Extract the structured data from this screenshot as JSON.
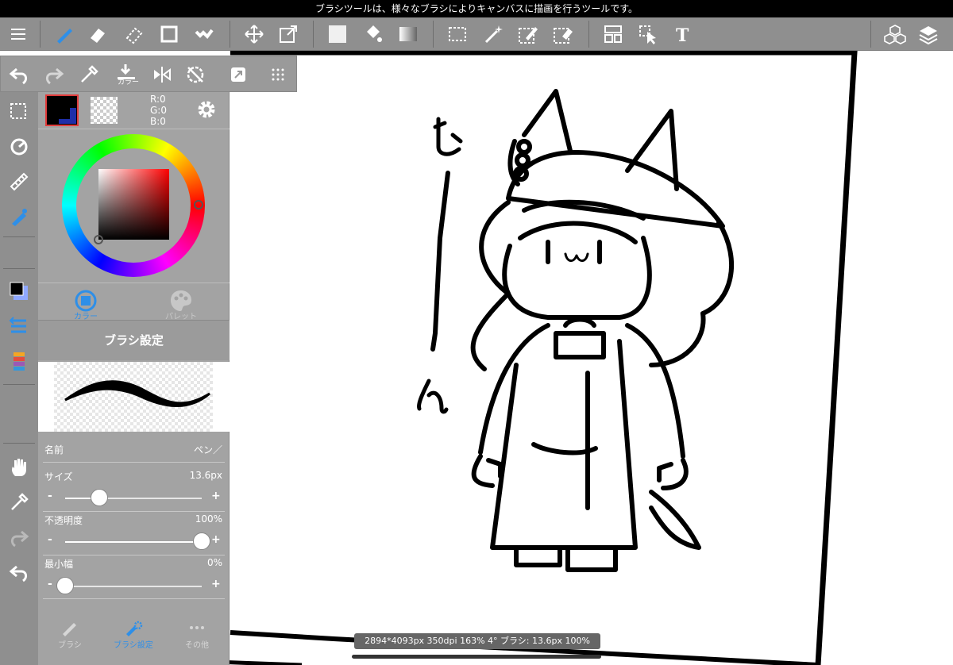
{
  "status_text": "ブラシツールは、様々なブラシによりキャンバスに描画を行うツールです。",
  "toolbar": {
    "menu_icon": "menu-icon",
    "tools": [
      "brush-icon",
      "eraser-icon",
      "blur-icon",
      "shape-icon",
      "dot-icon",
      "move-icon",
      "transform-icon",
      "fill-rect-icon",
      "bucket-icon",
      "gradient-icon",
      "select-rect-icon",
      "magic-wand-icon",
      "select-pen-icon",
      "select-eraser-icon",
      "frame-icon",
      "operation-icon",
      "text-icon",
      "material-icon",
      "layer-icon"
    ]
  },
  "subbar": {
    "extract_label": "カラー",
    "icons": [
      "undo-icon",
      "redo-icon",
      "eyedropper-icon",
      "extract-icon",
      "flip-icon",
      "rotate-reset-icon",
      "export-icon",
      "grid-icon"
    ]
  },
  "color_panel": {
    "main_color": "#000000",
    "rgb": {
      "r": "R:0",
      "g": "G:0",
      "b": "B:0"
    },
    "tabs": [
      {
        "label": "カラー",
        "icon": "color-icon",
        "active": true
      },
      {
        "label": "パレット",
        "icon": "palette-icon",
        "active": false
      }
    ]
  },
  "brush_panel": {
    "title": "ブラシ設定",
    "name_label": "名前",
    "name_value": "ペン／",
    "size": {
      "label": "サイズ",
      "value": "13.6px",
      "level": 0.25
    },
    "opacity": {
      "label": "不透明度",
      "value": "100%",
      "level": 1.0
    },
    "min_width": {
      "label": "最小幅",
      "value": "0%",
      "level": 0.0
    },
    "minus": "-",
    "plus": "+",
    "tabs": [
      {
        "label": "ブラシ",
        "icon": "brush-icon"
      },
      {
        "label": "ブラシ設定",
        "icon": "brush-settings-icon"
      },
      {
        "label": "その他",
        "icon": "more-icon"
      }
    ]
  },
  "info_bar": "2894*4093px 350dpi 163% 4° ブラシ: 13.6px 100%",
  "accent_color": "#2e8fe8"
}
